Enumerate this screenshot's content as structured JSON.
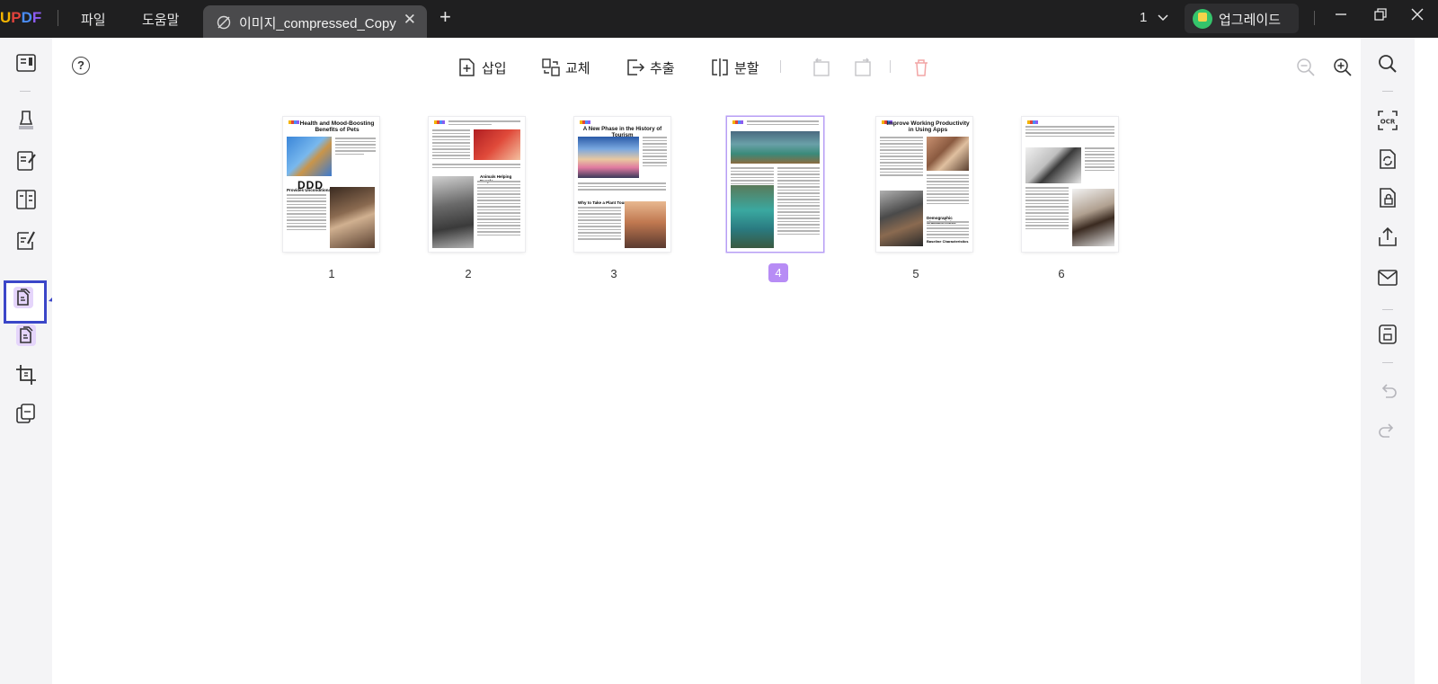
{
  "app": {
    "logo_text": "UPDF",
    "menu": [
      "파일",
      "도움말"
    ],
    "tab_title": "이미지_compressed_Copy",
    "page_selector": "1",
    "upgrade_label": "업그레이드"
  },
  "toolbar": {
    "insert": "삽입",
    "replace": "교체",
    "extract": "추출",
    "split": "분할"
  },
  "thumbnails": [
    {
      "page": "1",
      "title": "Health and Mood-Boosting Benefits of Pets",
      "subtitle": "Provides Unconditional Love",
      "logo_text": "DDD"
    },
    {
      "page": "2",
      "title": "",
      "subtitle": "Animals Helping People"
    },
    {
      "page": "3",
      "title": "A New Phase in the History of Tourism",
      "subtitle": "Why to Take a Plant Tour"
    },
    {
      "page": "4",
      "title": "",
      "subtitle": ""
    },
    {
      "page": "5",
      "title": "Improve Working Productivity in Using Apps",
      "subtitle": "Demographic Characteristics",
      "subtitle2": "Baseline Characteristics"
    },
    {
      "page": "6",
      "title": "",
      "subtitle": ""
    }
  ],
  "selected_page": "4",
  "colors": {
    "accent": "#b78cf5",
    "annotation_arrow": "#3b46c8",
    "titlebar": "#1f1f20"
  },
  "icons": {
    "left_rail": [
      "reader-icon",
      "comment-icon",
      "edit-pdf-icon",
      "form-icon",
      "sign-icon",
      "organize-pages-icon",
      "crop-icon",
      "page-tools-icon"
    ],
    "right_rail": [
      "search-icon",
      "ocr-icon",
      "convert-icon",
      "protect-icon",
      "share-icon",
      "email-icon",
      "save-icon",
      "undo-icon",
      "redo-icon"
    ]
  },
  "ocr_label": "OCR"
}
